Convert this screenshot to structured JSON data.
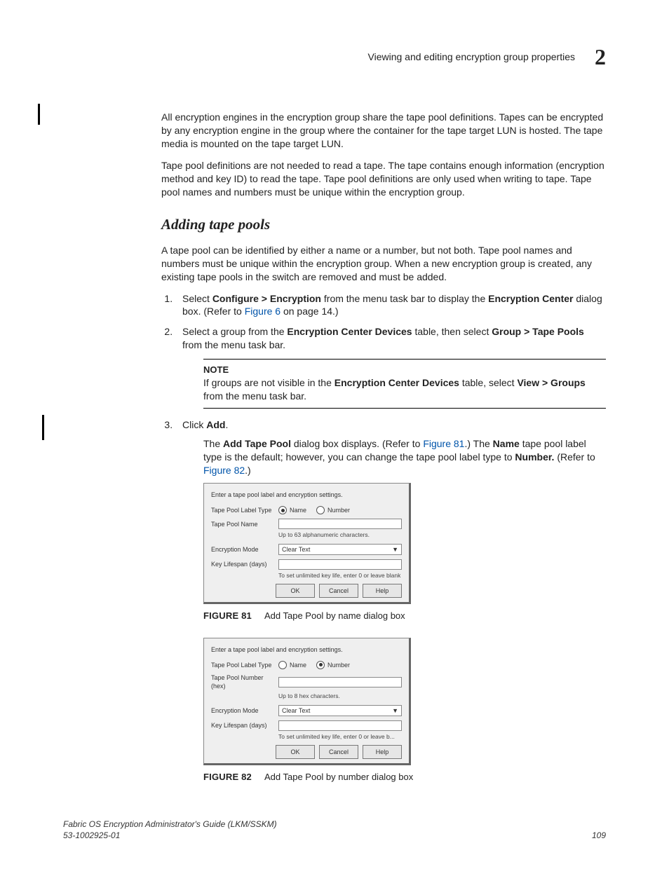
{
  "header": {
    "running_title": "Viewing and editing encryption group properties",
    "chapter_number": "2"
  },
  "intro": {
    "p1": "All encryption engines in the encryption group share the tape pool definitions. Tapes can be encrypted by any encryption engine in the group where the container for the tape target LUN is hosted. The tape media is mounted on the tape target LUN.",
    "p2": "Tape pool definitions are not needed to read a tape. The tape contains enough information (encryption method and key ID) to read the tape. Tape pool definitions are only used when writing to tape. Tape pool names and numbers must be unique within the encryption group."
  },
  "section": {
    "heading": "Adding tape pools",
    "p1": "A tape pool can be identified by either a name or a number, but not both. Tape pool names and numbers must be unique within the encryption group. When a new encryption group is created, any existing tape pools in the switch are removed and must be added."
  },
  "steps": {
    "s1_pre": "Select ",
    "s1_bold1": "Configure > Encryption",
    "s1_mid": " from the menu task bar to display the ",
    "s1_bold2": "Encryption Center",
    "s1_post1": " dialog box. (Refer to ",
    "s1_link": "Figure 6",
    "s1_post2": " on page 14.)",
    "s2_pre": "Select a group from the ",
    "s2_bold1": "Encryption Center Devices",
    "s2_mid": " table, then select ",
    "s2_bold2": "Group > Tape Pools",
    "s2_post": " from the menu task bar.",
    "note_label": "NOTE",
    "note_pre": "If groups are not visible in the ",
    "note_bold1": "Encryption Center Devices",
    "note_mid": " table, select ",
    "note_bold2": "View > Groups",
    "note_post": " from the menu task bar.",
    "s3_pre": "Click ",
    "s3_bold": "Add",
    "s3_post": ".",
    "s3b_pre": "The ",
    "s3b_bold1": "Add Tape Pool",
    "s3b_mid1": " dialog box displays. (Refer to ",
    "s3b_link1": "Figure 81",
    "s3b_mid2": ".) The ",
    "s3b_bold2": "Name",
    "s3b_mid3": " tape pool label type is the default; however, you can change the tape pool label type to ",
    "s3b_bold3": "Number.",
    "s3b_mid4": " (Refer to ",
    "s3b_link2": "Figure 82",
    "s3b_post": ".)"
  },
  "dialog1": {
    "instr": "Enter a tape pool label and encryption settings.",
    "label_type": "Tape Pool Label Type",
    "radio_name": "Name",
    "radio_number": "Number",
    "name_label": "Tape Pool Name",
    "name_hint": "Up to 63 alphanumeric characters.",
    "enc_label": "Encryption Mode",
    "enc_value": "Clear Text",
    "life_label": "Key Lifespan (days)",
    "life_hint": "To set unlimited key life, enter 0 or leave blank",
    "btn_ok": "OK",
    "btn_cancel": "Cancel",
    "btn_help": "Help"
  },
  "fig81": {
    "label": "FIGURE 81",
    "title": "Add Tape Pool by name dialog box"
  },
  "dialog2": {
    "instr": "Enter a tape pool label and encryption settings.",
    "label_type": "Tape Pool Label Type",
    "radio_name": "Name",
    "radio_number": "Number",
    "num_label": "Tape Pool Number (hex)",
    "num_hint": "Up to 8 hex characters.",
    "enc_label": "Encryption Mode",
    "enc_value": "Clear Text",
    "life_label": "Key Lifespan (days)",
    "life_hint": "To set unlimited key life, enter 0 or leave b...",
    "btn_ok": "OK",
    "btn_cancel": "Cancel",
    "btn_help": "Help"
  },
  "fig82": {
    "label": "FIGURE 82",
    "title": "Add Tape Pool by number dialog box"
  },
  "footer": {
    "line1": "Fabric OS Encryption Administrator's Guide  (LKM/SSKM)",
    "line2": "53-1002925-01",
    "page": "109"
  }
}
